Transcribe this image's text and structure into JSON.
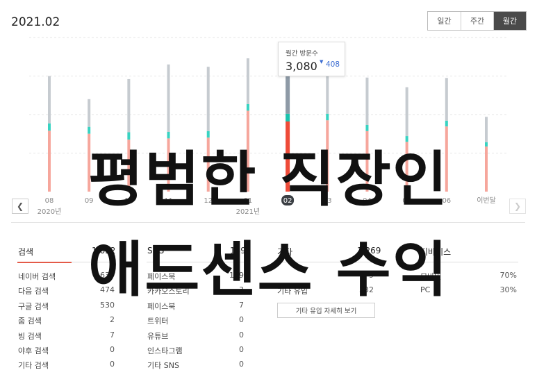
{
  "header": {
    "period": "2021.02"
  },
  "toggle": {
    "options": [
      "일간",
      "주간",
      "월간"
    ],
    "active": 2
  },
  "chart_data": {
    "type": "bar",
    "categories": [
      "08",
      "09",
      "10",
      "11",
      "12",
      "01",
      "02",
      "03",
      "04",
      "05",
      "06",
      "이번달"
    ],
    "year_labels": [
      {
        "text": "2020년",
        "at": 0
      },
      {
        "text": "2021년",
        "at": 5
      }
    ],
    "highlight_index": 6,
    "stacks": [
      {
        "total": 3000,
        "mid": 100,
        "low": 1580
      },
      {
        "total": 2400,
        "mid": 90,
        "low": 1500
      },
      {
        "total": 2920,
        "mid": 100,
        "low": 1350
      },
      {
        "total": 3300,
        "mid": 80,
        "low": 1380
      },
      {
        "total": 3240,
        "mid": 80,
        "low": 1400
      },
      {
        "total": 3460,
        "mid": 80,
        "low": 2100
      },
      {
        "total": 3080,
        "mid": 110,
        "low": 1820
      },
      {
        "total": 3180,
        "mid": 80,
        "low": 1850
      },
      {
        "total": 2960,
        "mid": 70,
        "low": 1570
      },
      {
        "total": 2710,
        "mid": 60,
        "low": 1290
      },
      {
        "total": 2950,
        "mid": 60,
        "low": 1690
      },
      {
        "total": 1940,
        "mid": 20,
        "low": 1170
      }
    ],
    "colors": {
      "top": "#c6cbd0",
      "mid": "#38d3c2",
      "low": "#f6a69c",
      "top_active": "#8e9aa6",
      "mid_active": "#1bc2ad",
      "low_active": "#ee4b38"
    },
    "ylim": [
      0,
      4000
    ],
    "grid": true
  },
  "tooltip": {
    "title": "월간 방문수",
    "value": "3,080",
    "arrow": "▼",
    "delta": "408"
  },
  "stats": {
    "search": {
      "title": "검색",
      "total": "1,652",
      "rows": [
        {
          "label": "네이버 검색",
          "value": "639"
        },
        {
          "label": "다음 검색",
          "value": "474"
        },
        {
          "label": "구글 검색",
          "value": "530"
        },
        {
          "label": "줌 검색",
          "value": "2"
        },
        {
          "label": "빙 검색",
          "value": "7"
        },
        {
          "label": "야후 검색",
          "value": "0"
        },
        {
          "label": "기타 검색",
          "value": "0"
        }
      ]
    },
    "sns": {
      "title": "SNS",
      "total": "159",
      "rows": [
        {
          "label": "페이스북",
          "value": "149"
        },
        {
          "label": "카카오스토리",
          "value": "3"
        },
        {
          "label": "페이스북",
          "value": "7"
        },
        {
          "label": "트위터",
          "value": "0"
        },
        {
          "label": "유튜브",
          "value": "0"
        },
        {
          "label": "인스타그램",
          "value": "0"
        },
        {
          "label": "기타 SNS",
          "value": "0"
        }
      ]
    },
    "other": {
      "title": "기타",
      "total": "1,269",
      "rows": [
        {
          "label": "",
          "value": "9"
        },
        {
          "label": "기타 유입",
          "value": "332"
        }
      ],
      "detail_button": "기타 유입 자세히 보기"
    },
    "device": {
      "title": "디바이스",
      "rows": [
        {
          "label": "모바일",
          "value": "70%"
        },
        {
          "label": "PC",
          "value": "30%"
        }
      ]
    }
  },
  "overlay": {
    "line1": "평범한 직장인",
    "line2": "애드센스 수익"
  },
  "icons": {
    "prev": "chevron-left-icon",
    "next": "chevron-right-icon"
  }
}
